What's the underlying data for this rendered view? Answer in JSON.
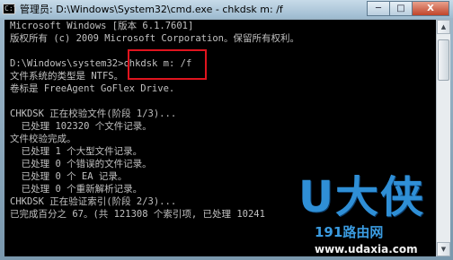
{
  "window": {
    "title": "管理员: D:\\Windows\\System32\\cmd.exe - chkdsk  m: /f",
    "app_icon_glyph": "C:\\",
    "controls": {
      "minimize": "─",
      "maximize": "□",
      "close": "X"
    }
  },
  "console": {
    "lines": [
      "Microsoft Windows [版本 6.1.7601]",
      "版权所有 (c) 2009 Microsoft Corporation。保留所有权利。",
      "",
      "D:\\Windows\\system32>chkdsk m: /f",
      "文件系统的类型是 NTFS。",
      "卷标是 FreeAgent GoFlex Drive.",
      "",
      "CHKDSK 正在校验文件(阶段 1/3)...",
      "  已处理 102320 个文件记录。",
      "文件校验完成。",
      "  已处理 1 个大型文件记录。",
      "  已处理 0 个错误的文件记录。",
      "  已处理 0 个 EA 记录。",
      "  已处理 0 个重新解析记录。",
      "CHKDSK 正在验证索引(阶段 2/3)...",
      "已完成百分之 67。(共 121308 个索引项, 已处理 10241"
    ],
    "highlighted_command": "chkdsk m: /f",
    "text_color": "#c0c0c0",
    "background_color": "#000000",
    "highlight_color": "#e0141e"
  },
  "scrollbar": {
    "up_arrow": "▲",
    "down_arrow": "▼"
  },
  "watermark": {
    "brand": "U大侠",
    "url_prefix": "191",
    "url_cn": "路由网",
    "url_domain": "www.udaxia.com"
  }
}
